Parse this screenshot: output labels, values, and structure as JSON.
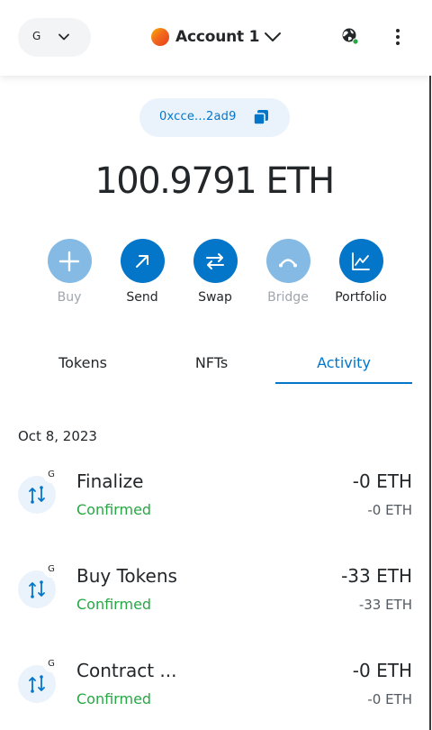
{
  "header": {
    "network_letter": "G",
    "account_name": "Account 1"
  },
  "address": {
    "short": "0xcce...2ad9"
  },
  "balance": {
    "text": "100.9791 ETH"
  },
  "actions": [
    {
      "label": "Buy",
      "icon": "plus-icon",
      "enabled": false
    },
    {
      "label": "Send",
      "icon": "arrow-up-right-icon",
      "enabled": true
    },
    {
      "label": "Swap",
      "icon": "swap-arrows-icon",
      "enabled": true
    },
    {
      "label": "Bridge",
      "icon": "bridge-icon",
      "enabled": false
    },
    {
      "label": "Portfolio",
      "icon": "chart-icon",
      "enabled": true
    }
  ],
  "tabs": [
    {
      "label": "Tokens",
      "active": false
    },
    {
      "label": "NFTs",
      "active": false
    },
    {
      "label": "Activity",
      "active": true
    }
  ],
  "activity": {
    "date": "Oct 8, 2023",
    "items": [
      {
        "badge": "G",
        "title": "Finalize",
        "status": "Confirmed",
        "primary": "-0 ETH",
        "secondary": "-0 ETH"
      },
      {
        "badge": "G",
        "title": "Buy Tokens",
        "status": "Confirmed",
        "primary": "-33 ETH",
        "secondary": "-33 ETH"
      },
      {
        "badge": "G",
        "title": "Contract ...",
        "status": "Confirmed",
        "primary": "-0 ETH",
        "secondary": "-0 ETH"
      }
    ]
  },
  "colors": {
    "accent": "#0376c9",
    "accent_disabled": "#84bae4",
    "success": "#28a745",
    "connected_dot": "#28a745"
  }
}
